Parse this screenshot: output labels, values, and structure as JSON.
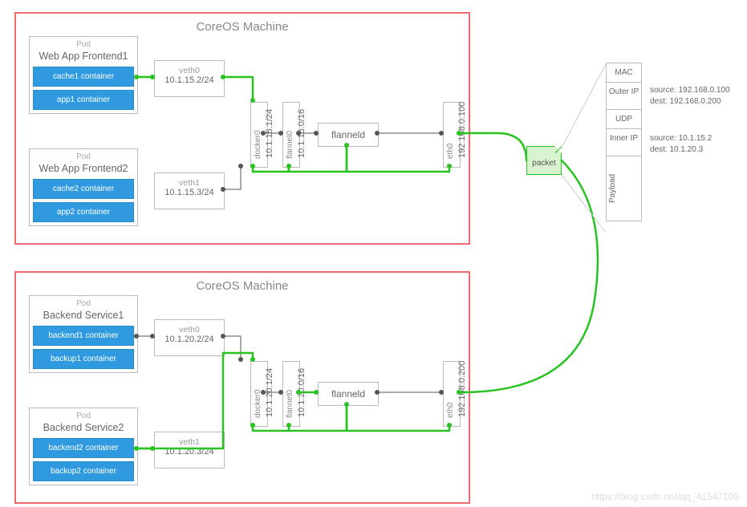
{
  "watermark": "https://blog.csdn.net/qq_41547105",
  "packet_label": "packet",
  "pod_word": "Pod",
  "machines": [
    {
      "title": "CoreOS Machine",
      "pods": [
        {
          "name": "Web App Frontend1",
          "containers": [
            "cache1 container",
            "app1 container"
          ]
        },
        {
          "name": "Web App Frontend2",
          "containers": [
            "cache2 container",
            "app2 container"
          ]
        }
      ],
      "veths": [
        {
          "name": "veth0",
          "ip": "10.1.15.2/24"
        },
        {
          "name": "veth1",
          "ip": "10.1.15.3/24"
        }
      ],
      "docker0": {
        "label": "docker0",
        "ip": "10.1.15.1/24"
      },
      "flannel0": {
        "label": "flannel0",
        "ip": "10.1.15.0/16"
      },
      "flanneld": "flanneld",
      "eth0": {
        "label": "eth0",
        "ip": "192.168.0.100"
      }
    },
    {
      "title": "CoreOS Machine",
      "pods": [
        {
          "name": "Backend Service1",
          "containers": [
            "backend1 container",
            "backup1 container"
          ]
        },
        {
          "name": "Backend Service2",
          "containers": [
            "backend2 container",
            "backup2 container"
          ]
        }
      ],
      "veths": [
        {
          "name": "veth0",
          "ip": "10.1.20.2/24"
        },
        {
          "name": "veth1",
          "ip": "10.1.20.3/24"
        }
      ],
      "docker0": {
        "label": "docker0",
        "ip": "10.1.20.1/24"
      },
      "flannel0": {
        "label": "flannel0",
        "ip": "10.1.20.0/16"
      },
      "flanneld": "flanneld",
      "eth0": {
        "label": "eth0",
        "ip": "192.168.0.200"
      }
    }
  ],
  "packet_detail": {
    "mac": "MAC",
    "outer_ip": "Outer IP",
    "udp": "UDP",
    "inner_ip": "Inner IP",
    "payload": "Payload",
    "outer_source": "source: 192.168.0.100",
    "outer_dest": "dest: 192.168.0.200",
    "inner_source": "source: 10.1.15.2",
    "inner_dest": "dest: 10.1.20.3"
  }
}
